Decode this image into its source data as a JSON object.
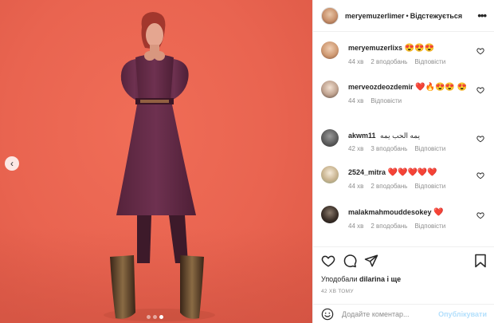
{
  "post": {
    "author": "meryemuzerlimer",
    "separator": "•",
    "follow_status": "Відстежується",
    "more_icon": "more-horizontal-icon"
  },
  "comments": [
    {
      "user": "meryemuzerlixs",
      "emoji": "😍😍😍",
      "time": "44 хв",
      "likes": "2 вподобань",
      "reply": "Відповісти"
    },
    {
      "user": "merveozdeozdemir",
      "emoji": "❤️🔥😍😍 😍",
      "time": "44 хв",
      "likes": "",
      "reply": "Відповісти"
    },
    {
      "user": "akwm11",
      "text": "يمه الحب يمه",
      "time": "42 хв",
      "likes": "3 вподобань",
      "reply": "Відповісти"
    },
    {
      "user": "2524_mitra",
      "emoji": "❤️❤️❤️❤️❤️",
      "time": "44 хв",
      "likes": "2 вподобань",
      "reply": "Відповісти"
    },
    {
      "user": "malakmahmouddesokey",
      "emoji": "❤️",
      "time": "44 хв",
      "likes": "2 вподобань",
      "reply": "Відповісти"
    }
  ],
  "actions": {
    "likes_prefix": "Уподобали",
    "liked_by": "dilarina",
    "likes_suffix": "і ще",
    "timestamp": "42 ХВ ТОМУ"
  },
  "composer": {
    "placeholder": "Додайте коментар...",
    "publish_label": "Опублікувати"
  },
  "carousel": {
    "slide_count": 3,
    "active_index": 2
  },
  "colors": {
    "background": "#e96450",
    "dress": "#6a2f4c",
    "link": "#b2dffc",
    "heart_red": "#ed4956"
  }
}
